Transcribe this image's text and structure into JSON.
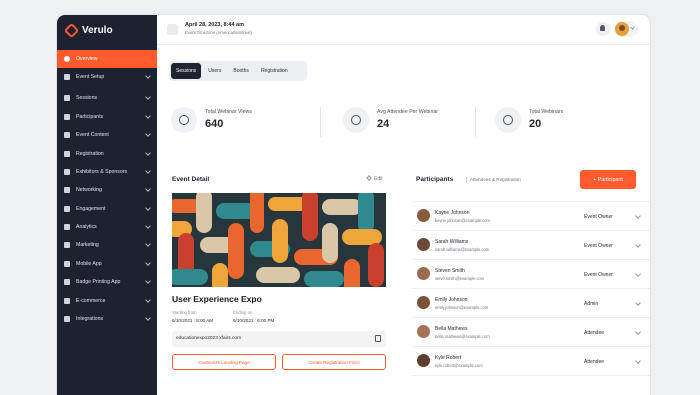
{
  "brand": {
    "name": "Verulo"
  },
  "header": {
    "date": "April 28, 2023, 8:44 am",
    "timezone": "Event Timezone (America/Montreal)"
  },
  "sidebar": {
    "items": [
      {
        "label": "Overview",
        "icon": "home-icon",
        "active": true
      },
      {
        "label": "Event Setup",
        "icon": "gear-icon"
      },
      {
        "label": "Sessions",
        "icon": "grid-icon"
      },
      {
        "label": "Participants",
        "icon": "users-icon"
      },
      {
        "label": "Event Content",
        "icon": "document-icon"
      },
      {
        "label": "Registration",
        "icon": "user-plus-icon"
      },
      {
        "label": "Exhibitors & Sponsors",
        "icon": "gear-icon"
      },
      {
        "label": "Networking",
        "icon": "share-icon"
      },
      {
        "label": "Engagement",
        "icon": "flag-icon"
      },
      {
        "label": "Analytics",
        "icon": "chart-icon"
      },
      {
        "label": "Marketing",
        "icon": "send-icon"
      },
      {
        "label": "Mobile App",
        "icon": "phone-icon"
      },
      {
        "label": "Badge Printing App",
        "icon": "printer-icon"
      },
      {
        "label": "E-commerce",
        "icon": "cart-icon"
      },
      {
        "label": "Integrations",
        "icon": "plus-square-icon"
      }
    ]
  },
  "tabs": [
    "Sessions",
    "Users",
    "Booths",
    "Registration"
  ],
  "stats": [
    {
      "label": "Total Webinar Views",
      "value": "640",
      "icon": "eye-icon"
    },
    {
      "label": "Avg Attendee Per Webinar",
      "value": "24",
      "icon": "users-icon"
    },
    {
      "label": "Total Webinars",
      "value": "20",
      "icon": "play-icon"
    }
  ],
  "event_detail": {
    "title": "Event Detail",
    "edit_label": "Edit",
    "name": "User Experience Expo",
    "start_label": "Starting from",
    "start_value": "6/10/2021 : 8:00 AM",
    "end_label": "Ending on",
    "end_value": "6/10/2021 : 6:00 PM",
    "url": "educationexpo2023.xfairs.com",
    "landing_button": "Customize Landing Page",
    "registration_button": "Create Registration Form"
  },
  "participants": {
    "title": "Participants",
    "subtitle": "Attendees & Registration",
    "add_button": "+ Participant",
    "rows": [
      {
        "name": "Kayne Johnson",
        "email": "kayne.johnson@example.com",
        "role": "Event Owner"
      },
      {
        "name": "Sarah Williams",
        "email": "sarah.williams@example.com",
        "role": "Event Owner"
      },
      {
        "name": "Steven Smith",
        "email": "steve.smith@example.com",
        "role": "Event Owner"
      },
      {
        "name": "Emily Johnson",
        "email": "emily.johnson@example.com",
        "role": "Admin"
      },
      {
        "name": "Bella Mathews",
        "email": "bella.mathews@example.com",
        "role": "Attendee"
      },
      {
        "name": "Kyle Robert",
        "email": "kyle.robert@example.com",
        "role": "Attendee"
      }
    ]
  },
  "colors": {
    "accent": "#ff5b2e",
    "sidebar_bg": "#1e2230"
  }
}
